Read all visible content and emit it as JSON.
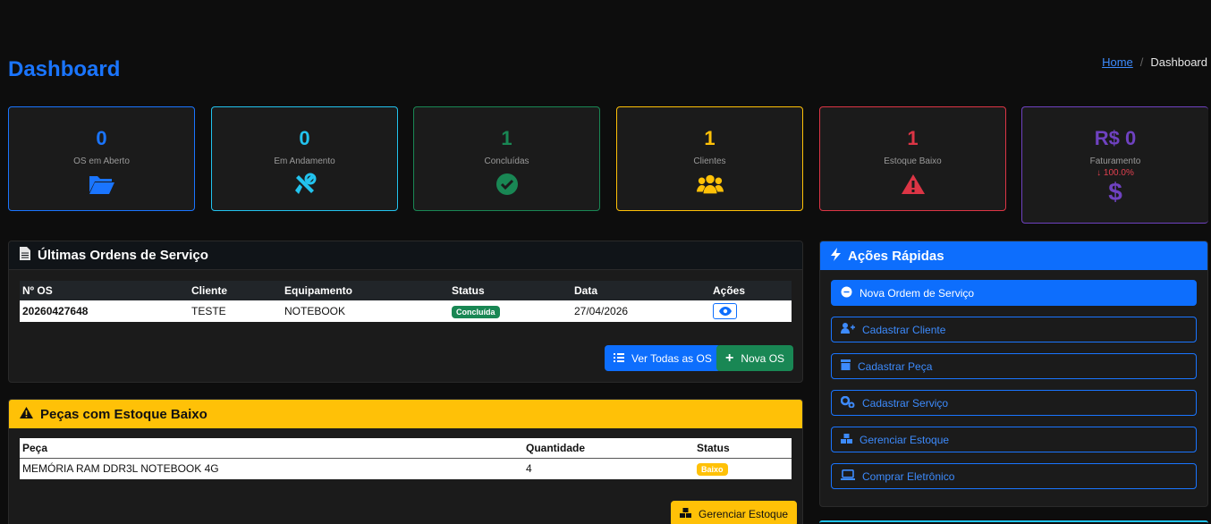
{
  "header": {
    "title": "Dashboard"
  },
  "breadcrumb": {
    "home": "Home",
    "current": "Dashboard"
  },
  "stats": [
    {
      "value": "0",
      "label": "OS em Aberto",
      "color": "#1a75ff",
      "icon": "folder-open-icon"
    },
    {
      "value": "0",
      "label": "Em Andamento",
      "color": "#22c3ee",
      "icon": "tools-icon"
    },
    {
      "value": "1",
      "label": "Concluídas",
      "color": "#198754",
      "icon": "check-circle-icon"
    },
    {
      "value": "1",
      "label": "Clientes",
      "color": "#ffc107",
      "icon": "users-icon"
    },
    {
      "value": "1",
      "label": "Estoque Baixo",
      "color": "#dc3545",
      "icon": "warning-icon"
    },
    {
      "value": "R$ 0",
      "label": "Faturamento",
      "trend": "100.0%",
      "color": "#6f42c1",
      "icon": "dollar-icon"
    }
  ],
  "orders": {
    "title": "Últimas Ordens de Serviço",
    "columns": [
      "Nº OS",
      "Cliente",
      "Equipamento",
      "Status",
      "Data",
      "Ações"
    ],
    "rows": [
      {
        "os": "20260427648",
        "cliente": "TESTE",
        "equipamento": "NOTEBOOK",
        "status": "Concluída",
        "data": "27/04/2026"
      }
    ],
    "view_all_label": "Ver Todas as OS",
    "new_label": "Nova OS"
  },
  "low_stock": {
    "title": "Peças com Estoque Baixo",
    "columns": [
      "Peça",
      "Quantidade",
      "Status"
    ],
    "rows": [
      {
        "peca": "MEMÓRIA RAM DDR3L NOTEBOOK 4G",
        "quantidade": "4",
        "status": "Baixo"
      }
    ],
    "manage_label": "Gerenciar Estoque"
  },
  "quick_actions": {
    "title": "Ações Rápidas",
    "items": [
      {
        "label": "Nova Ordem de Serviço",
        "icon": "plus-circle-icon"
      },
      {
        "label": "Cadastrar Cliente",
        "icon": "user-plus-icon"
      },
      {
        "label": "Cadastrar Peça",
        "icon": "box-icon"
      },
      {
        "label": "Cadastrar Serviço",
        "icon": "gears-icon"
      },
      {
        "label": "Gerenciar Estoque",
        "icon": "boxes-icon"
      },
      {
        "label": "Comprar Eletrônico",
        "icon": "laptop-icon"
      }
    ]
  }
}
